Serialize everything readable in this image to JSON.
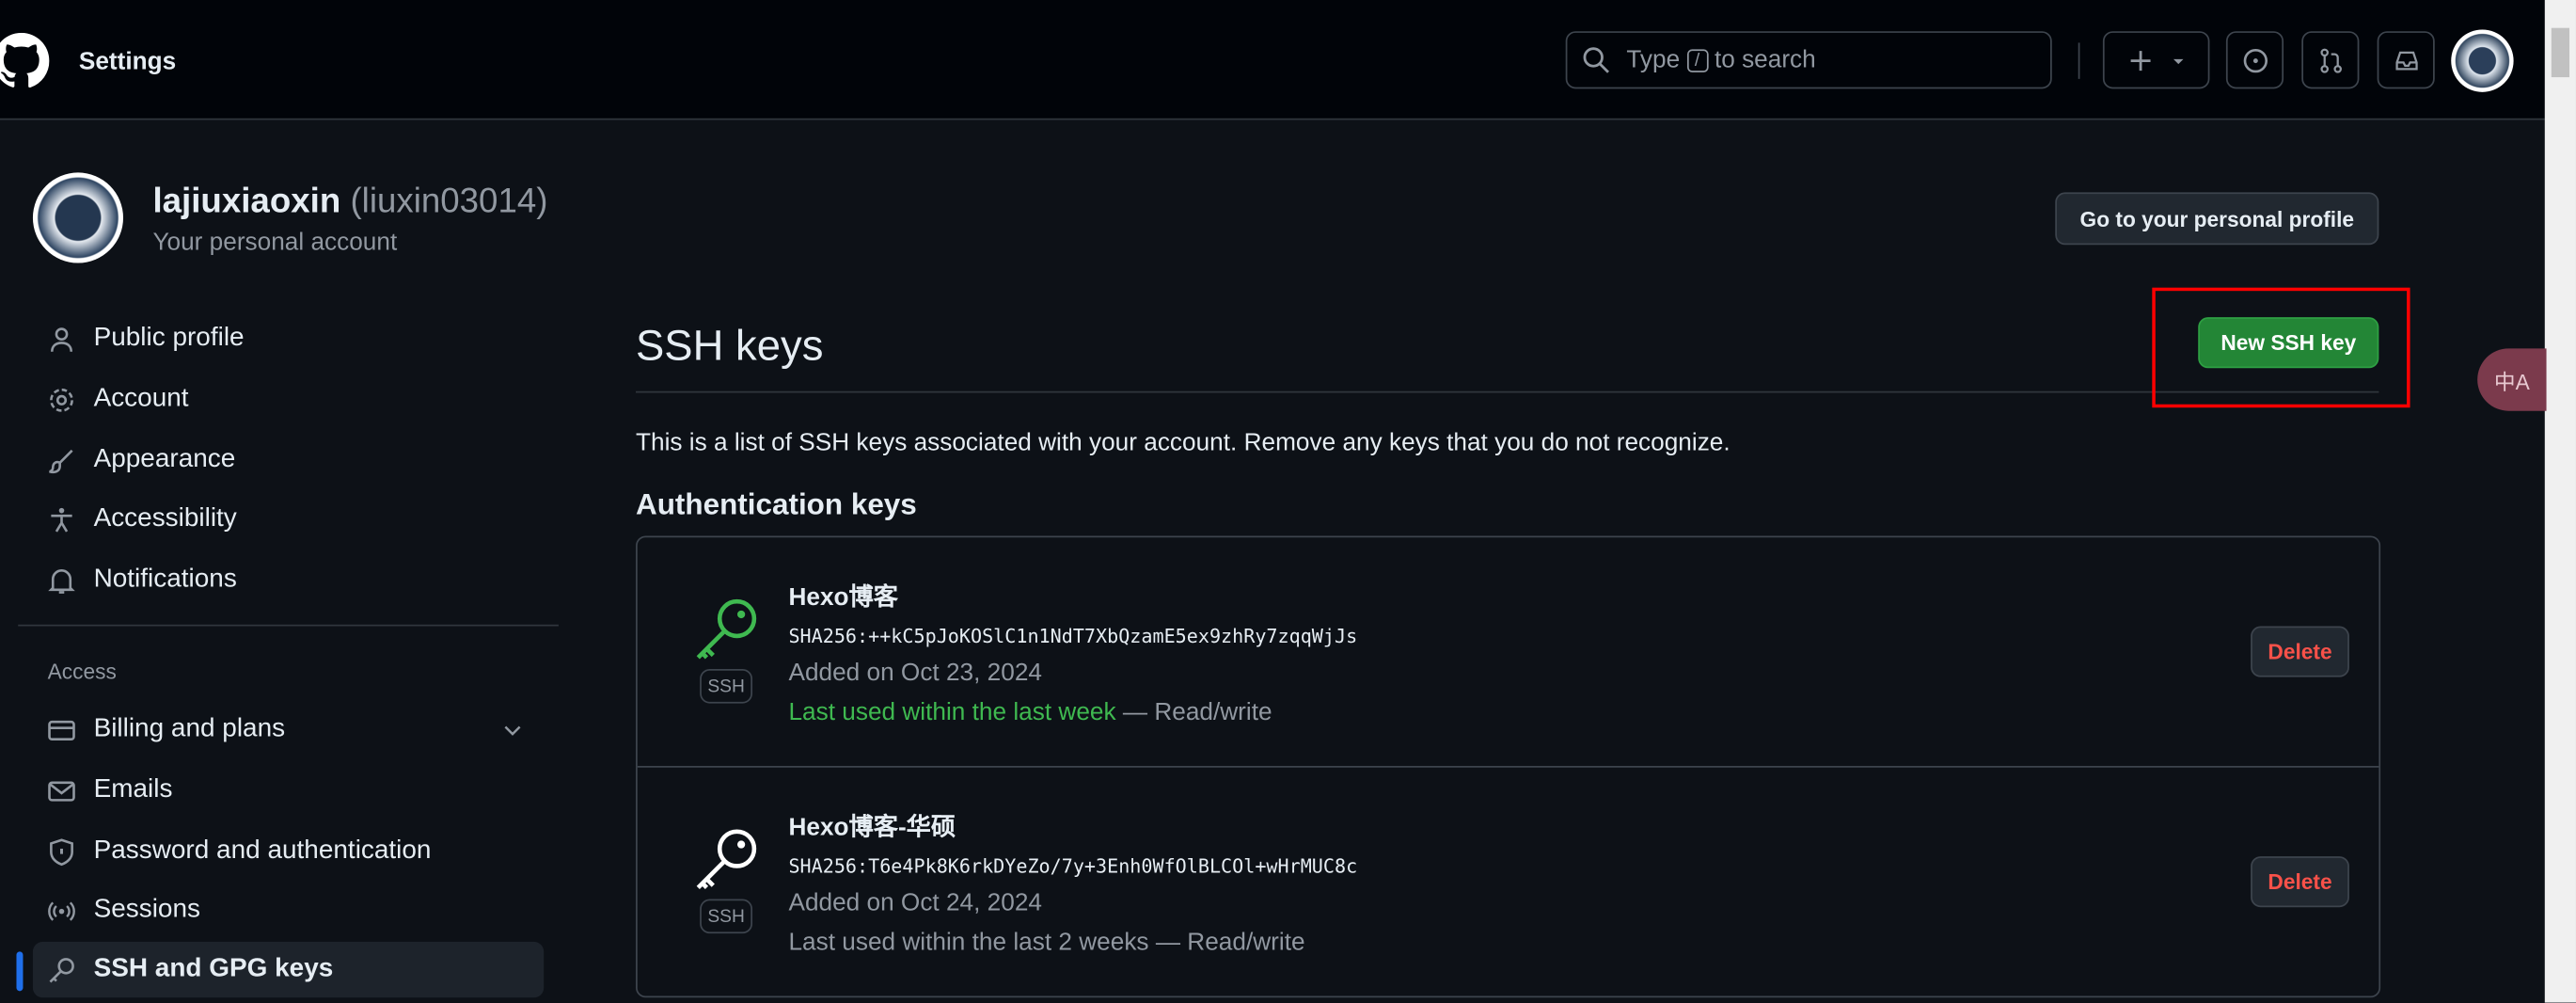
{
  "header": {
    "title": "Settings",
    "search_prefix": "Type",
    "search_key": "/",
    "search_suffix": "to search",
    "icons": [
      "github-logo",
      "search-icon",
      "plus-icon",
      "chevron-down-icon",
      "issues-icon",
      "pull-request-icon",
      "inbox-icon",
      "avatar"
    ]
  },
  "account": {
    "username": "lajiuxiaoxin",
    "login": "(liuxin03014)",
    "subtitle": "Your personal account",
    "profile_button": "Go to your personal profile"
  },
  "sidebar": {
    "items": [
      {
        "label": "Public profile",
        "icon": "person-icon"
      },
      {
        "label": "Account",
        "icon": "gear-icon"
      },
      {
        "label": "Appearance",
        "icon": "paintbrush-icon"
      },
      {
        "label": "Accessibility",
        "icon": "accessibility-icon"
      },
      {
        "label": "Notifications",
        "icon": "bell-icon"
      }
    ],
    "section_access": "Access",
    "access_items": [
      {
        "label": "Billing and plans",
        "icon": "credit-card-icon"
      },
      {
        "label": "Emails",
        "icon": "mail-icon"
      },
      {
        "label": "Password and authentication",
        "icon": "shield-icon"
      },
      {
        "label": "Sessions",
        "icon": "broadcast-icon"
      },
      {
        "label": "SSH and GPG keys",
        "icon": "key-icon",
        "selected": true
      }
    ]
  },
  "main": {
    "title": "SSH keys",
    "new_button": "New SSH key",
    "description": "This is a list of SSH keys associated with your account. Remove any keys that you do not recognize.",
    "section": "Authentication keys",
    "keys": [
      {
        "name": "Hexo博客",
        "fingerprint": "SHA256:++kC5pJoKOSlC1n1NdT7XbQzamE5ex9zhRy7zqqWjJs",
        "added": "Added on Oct 23, 2024",
        "last_used": "Last used within the last week",
        "access": "— Read/write",
        "badge": "SSH",
        "delete": "Delete",
        "recent": true
      },
      {
        "name": "Hexo博客-华硕",
        "fingerprint": "SHA256:T6e4Pk8K6rkDYeZo/7y+3Enh0WfOlBLCOl+wHrMUC8c",
        "added": "Added on Oct 24, 2024",
        "last_used": "Last used within the last 2 weeks",
        "access": "— Read/write",
        "badge": "SSH",
        "delete": "Delete",
        "recent": false
      }
    ]
  },
  "translate_widget": "中A",
  "colors": {
    "accent_green": "#238636",
    "recent_green": "#3fb950",
    "danger": "#f85149",
    "highlight_box": "#ff0000",
    "selected_indicator": "#1f6feb"
  }
}
